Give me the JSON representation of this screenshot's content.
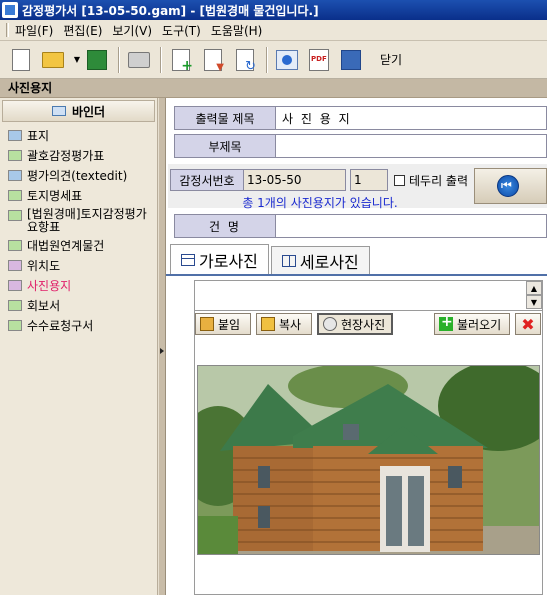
{
  "window": {
    "title": "감정평가서  [13-05-50.gam]   - [법원경매 물건입니다.]"
  },
  "menu": [
    {
      "label": "파일(F)"
    },
    {
      "label": "편집(E)"
    },
    {
      "label": "보기(V)"
    },
    {
      "label": "도구(T)"
    },
    {
      "label": "도움말(H)"
    }
  ],
  "toolbar": {
    "icons": [
      "new-document-icon",
      "open-folder-icon",
      "dropdown-arrow-icon",
      "save-icon",
      "print-icon",
      "add-document-icon",
      "download-document-icon",
      "refresh-document-icon",
      "info-icon",
      "pdf-icon",
      "floppy-icon"
    ],
    "close_label": "닫기"
  },
  "section": {
    "title": "사진용지"
  },
  "binder": {
    "header": "바인더",
    "items": [
      {
        "label": "표지",
        "color": "#a8c8e8"
      },
      {
        "label": "괄호감정평가표",
        "color": "#b8e0a0"
      },
      {
        "label": "평가의견(textedit)",
        "color": "#a8c8e8"
      },
      {
        "label": "토지명세표",
        "color": "#b8e0a0"
      },
      {
        "label": "[법원경매]토지감정평가요항표",
        "color": "#b8e0a0"
      },
      {
        "label": "대법원연계물건",
        "color": "#b8e0a0"
      },
      {
        "label": "위치도",
        "color": "#d8b8e0"
      },
      {
        "label": "사진용지",
        "color": "#d8b8e0",
        "active": true
      },
      {
        "label": "회보서",
        "color": "#b8e0a0"
      },
      {
        "label": "수수료청구서",
        "color": "#b8e0a0"
      }
    ]
  },
  "form": {
    "output_title_label": "출력물 제목",
    "output_title_value": "사 진 용 지",
    "subtitle_label": "부제목",
    "subtitle_value": "",
    "appraisal_no_label": "감정서번호",
    "appraisal_no_value": "13-05-50",
    "page_value": "1",
    "border_print_label": "테두리 출력",
    "border_print_checked": false,
    "photo_count_text": "총 1개의 사진용지가 있습니다.",
    "name_label": "건    명",
    "name_value": ""
  },
  "tabs": [
    {
      "label": "가로사진",
      "active": true
    },
    {
      "label": "세로사진",
      "active": false
    }
  ],
  "actions": {
    "paste": "붙임",
    "copy": "복사",
    "scene_photo": "현장사진",
    "load": "불러오기"
  }
}
